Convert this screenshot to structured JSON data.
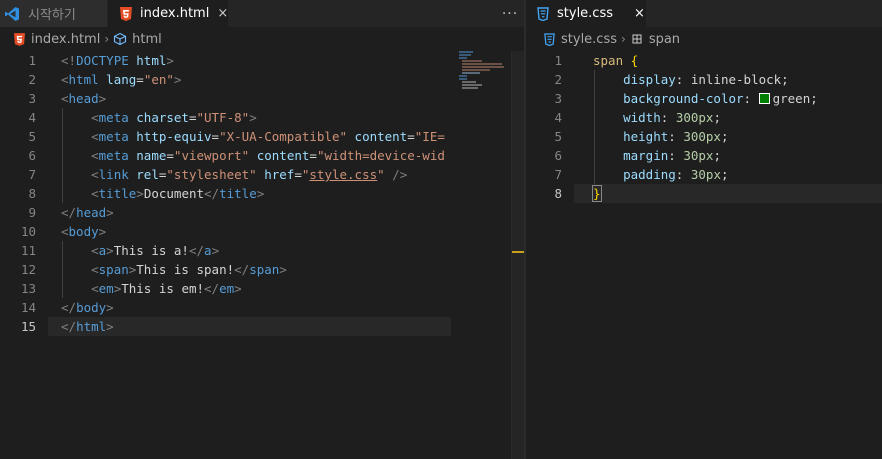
{
  "left_group": {
    "tabs": [
      {
        "label": "시작하기",
        "icon": "vscode-logo-icon",
        "active": false
      },
      {
        "label": "index.html",
        "icon": "html5-file-icon",
        "active": true,
        "close": "×"
      }
    ],
    "more_actions": "···",
    "breadcrumb": {
      "file": "index.html",
      "symbol": "html"
    },
    "line_numbers": [
      "1",
      "2",
      "3",
      "4",
      "5",
      "6",
      "7",
      "8",
      "9",
      "10",
      "11",
      "12",
      "13",
      "14",
      "15"
    ],
    "current_line": "15",
    "code": {
      "l1": {
        "open": "<!",
        "doctype": "DOCTYPE",
        "sp": " ",
        "html": "html",
        "close": ">"
      },
      "l2": {
        "open": "<",
        "tag": "html",
        "sp": " ",
        "attr": "lang",
        "eq": "=",
        "val": "\"en\"",
        "close": ">"
      },
      "l3": {
        "open": "<",
        "tag": "head",
        "close": ">"
      },
      "l4": {
        "indent": "    ",
        "open": "<",
        "tag": "meta",
        "sp": " ",
        "attr": "charset",
        "eq": "=",
        "val": "\"UTF-8\"",
        "close": ">"
      },
      "l5": {
        "indent": "    ",
        "open": "<",
        "tag": "meta",
        "sp": " ",
        "attr1": "http-equiv",
        "eq1": "=",
        "val1": "\"X-UA-Compatible\"",
        "sp2": " ",
        "attr2": "content",
        "eq2": "=",
        "val2": "\"IE="
      },
      "l6": {
        "indent": "    ",
        "open": "<",
        "tag": "meta",
        "sp": " ",
        "attr1": "name",
        "eq1": "=",
        "val1": "\"viewport\"",
        "sp2": " ",
        "attr2": "content",
        "eq2": "=",
        "val2": "\"width=device-wid"
      },
      "l7": {
        "indent": "    ",
        "open": "<",
        "tag": "link",
        "sp": " ",
        "attr1": "rel",
        "eq1": "=",
        "val1": "\"stylesheet\"",
        "sp2": " ",
        "attr2": "href",
        "eq2": "=",
        "q1": "\"",
        "link": "style.css",
        "q2": "\"",
        "close": " />"
      },
      "l8": {
        "indent": "    ",
        "open": "<",
        "tag": "title",
        "close": ">",
        "text": "Document",
        "open2": "</",
        "tag2": "title",
        "close2": ">"
      },
      "l9": {
        "open": "</",
        "tag": "head",
        "close": ">"
      },
      "l10": {
        "open": "<",
        "tag": "body",
        "close": ">"
      },
      "l11": {
        "indent": "    ",
        "open": "<",
        "tag": "a",
        "close": ">",
        "text": "This is a!",
        "open2": "</",
        "tag2": "a",
        "close2": ">"
      },
      "l12": {
        "indent": "    ",
        "open": "<",
        "tag": "span",
        "close": ">",
        "text": "This is span!",
        "open2": "</",
        "tag2": "span",
        "close2": ">"
      },
      "l13": {
        "indent": "    ",
        "open": "<",
        "tag": "em",
        "close": ">",
        "text": "This is em!",
        "open2": "</",
        "tag2": "em",
        "close2": ">"
      },
      "l14": {
        "open": "</",
        "tag": "body",
        "close": ">"
      },
      "l15": {
        "open": "</",
        "tag": "html",
        "close": ">"
      }
    }
  },
  "right_group": {
    "tab": {
      "label": "style.css",
      "icon": "css3-file-icon",
      "close": "×"
    },
    "breadcrumb": {
      "file": "style.css",
      "symbol": "span"
    },
    "line_numbers": [
      "1",
      "2",
      "3",
      "4",
      "5",
      "6",
      "7",
      "8"
    ],
    "current_line": "8",
    "code": {
      "l1": {
        "selector": "span",
        "sp": " ",
        "brace": "{"
      },
      "l2": {
        "indent": "    ",
        "prop": "display",
        "colon": ": ",
        "val": "inline-block",
        "semi": ";"
      },
      "l3": {
        "indent": "    ",
        "prop": "background-color",
        "colon": ": ",
        "val": "green",
        "semi": ";",
        "swatch_color": "#008000"
      },
      "l4": {
        "indent": "    ",
        "prop": "width",
        "colon": ": ",
        "num": "300",
        "unit": "px",
        "semi": ";"
      },
      "l5": {
        "indent": "    ",
        "prop": "height",
        "colon": ": ",
        "num": "300",
        "unit": "px",
        "semi": ";"
      },
      "l6": {
        "indent": "    ",
        "prop": "margin",
        "colon": ": ",
        "num": "30",
        "unit": "px",
        "semi": ";"
      },
      "l7": {
        "indent": "    ",
        "prop": "padding",
        "colon": ": ",
        "num": "30",
        "unit": "px",
        "semi": ";"
      },
      "l8": {
        "brace": "}"
      }
    }
  },
  "colors": {
    "editor_bg": "#1e1e1e",
    "tag": "#569cd6",
    "attribute": "#9cdcfe",
    "string": "#ce9178",
    "selector": "#d7ba7d",
    "number": "#b5cea8",
    "html_icon": "#e44d26",
    "css_icon": "#42a5f5",
    "vscode_icon": "#2f8fe0",
    "scroll_marker": "#c8a21a"
  }
}
